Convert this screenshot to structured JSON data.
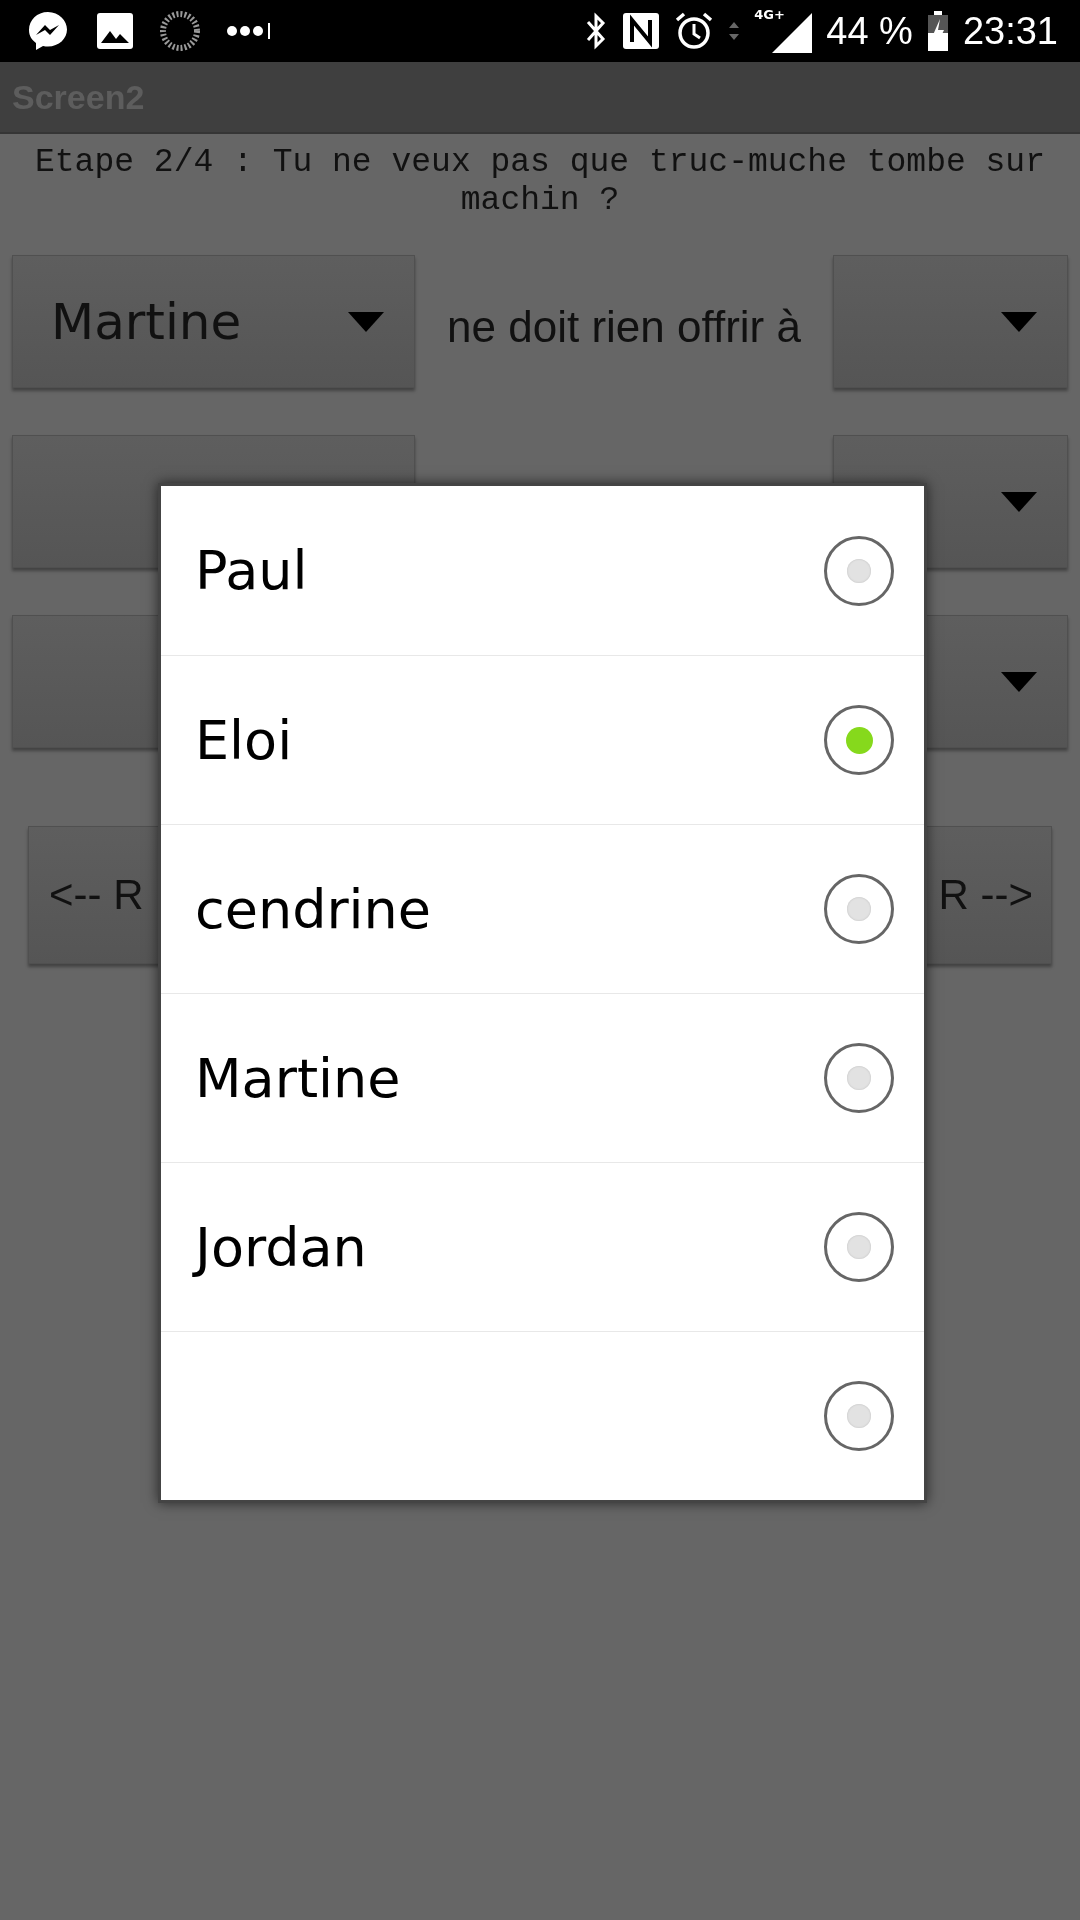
{
  "status_bar": {
    "network": "4G+",
    "battery": "44 %",
    "time": "23:31"
  },
  "title": "Screen2",
  "prompt": "Etape 2/4 : Tu ne veux pas que truc-muche tombe sur machin ?",
  "rows": [
    {
      "giver": "Martine",
      "label": "ne doit rien offrir à"
    },
    {},
    {}
  ],
  "nav_buttons": [
    "<-- R",
    "R -->"
  ],
  "dialog": {
    "options": [
      {
        "label": "Paul",
        "selected": false
      },
      {
        "label": "Eloi",
        "selected": true
      },
      {
        "label": "cendrine",
        "selected": false
      },
      {
        "label": "Martine",
        "selected": false
      },
      {
        "label": "Jordan",
        "selected": false
      },
      {
        "selected": false
      }
    ]
  }
}
